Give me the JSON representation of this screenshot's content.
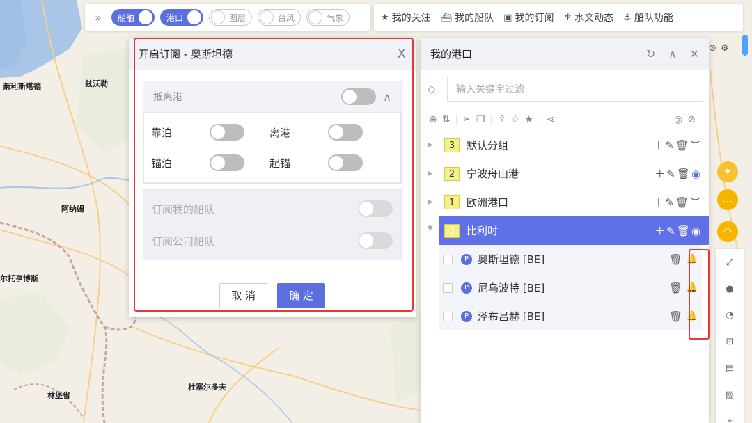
{
  "map": {
    "labels": {
      "l1": "莱利斯塔德",
      "l2": "兹沃勒",
      "l3": "阿纳姆",
      "l4": "尔托亨博斯",
      "l5": "杜塞尔多夫",
      "l6": "林堡省"
    },
    "colors": {
      "land": "#f3efe6",
      "water": "#a9c6e8",
      "border": "#c9a7a0",
      "road": "#f5d089"
    }
  },
  "toolbar": {
    "collapse_icon": "»",
    "toggles": [
      {
        "label": "船舶",
        "on": true
      },
      {
        "label": "港口",
        "on": true
      },
      {
        "label": "图层",
        "on": false
      },
      {
        "label": "台风",
        "on": false
      },
      {
        "label": "气象",
        "on": false
      }
    ]
  },
  "menu": {
    "items": [
      {
        "label": "我的关注",
        "icon": "star-icon"
      },
      {
        "label": "我的船队",
        "icon": "ship-icon"
      },
      {
        "label": "我的订阅",
        "icon": "bookmark-plus-icon"
      },
      {
        "label": "水文动态",
        "icon": "hydro-icon"
      },
      {
        "label": "船队功能",
        "icon": "fleet-icon"
      }
    ]
  },
  "dialog": {
    "title": "开启订阅 - 奥斯坦德",
    "close": "X",
    "section": {
      "title": "抵离港",
      "items": [
        {
          "label": "靠泊"
        },
        {
          "label": "离港"
        },
        {
          "label": "锚泊"
        },
        {
          "label": "起锚"
        }
      ]
    },
    "subs": [
      {
        "label": "订阅我的船队"
      },
      {
        "label": "订阅公司船队"
      }
    ],
    "cancel_label": "取 消",
    "ok_label": "确 定"
  },
  "ports_panel": {
    "title": "我的港口",
    "filter_placeholder": "输入关键字过滤",
    "groups": [
      {
        "count": "3",
        "name": "默认分组"
      },
      {
        "count": "2",
        "name": "宁波舟山港"
      },
      {
        "count": "1",
        "name": "欧洲港口"
      },
      {
        "count": "3",
        "name": "比利时"
      }
    ],
    "ports": [
      {
        "badge": "P",
        "name": "奥斯坦德 [BE]"
      },
      {
        "badge": "P",
        "name": "尼乌波特 [BE]"
      },
      {
        "badge": "P",
        "name": "泽布吕赫 [BE]"
      }
    ]
  },
  "accent_color": "#5b6fdf",
  "highlight_color": "#e53935"
}
